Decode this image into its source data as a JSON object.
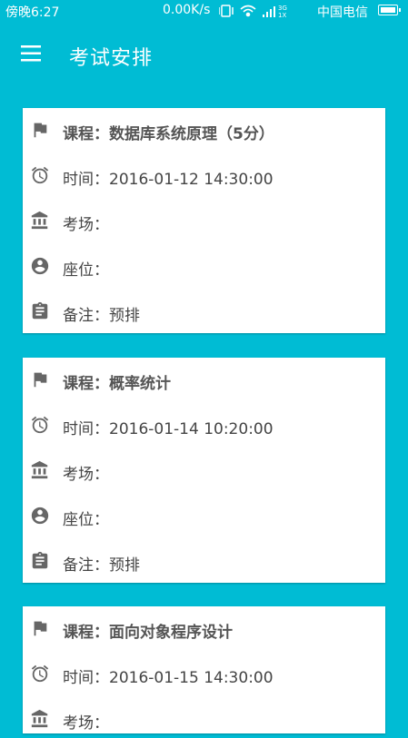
{
  "status_bar": {
    "time": "傍晚6:27",
    "speed": "0.00K/s",
    "carrier": "中国电信"
  },
  "app_bar": {
    "title": "考试安排"
  },
  "exams": [
    {
      "course": "课程：数据库系统原理（5分）",
      "time": "时间：2016-01-12 14:30:00",
      "room": "考场：",
      "seat": "座位：",
      "note": "备注：预排"
    },
    {
      "course": "课程：概率统计",
      "time": "时间：2016-01-14 10:20:00",
      "room": "考场：",
      "seat": "座位：",
      "note": "备注：预排"
    },
    {
      "course": "课程：面向对象程序设计",
      "time": "时间：2016-01-15 14:30:00",
      "room": "考场："
    }
  ],
  "icons": {
    "course": "flag-icon",
    "time": "alarm-icon",
    "room": "bank-icon",
    "seat": "account-circle-icon",
    "note": "clipboard-icon"
  },
  "colors": {
    "primary": "#00bcd4",
    "card": "#ffffff",
    "icon": "#666666",
    "text": "#444444"
  }
}
